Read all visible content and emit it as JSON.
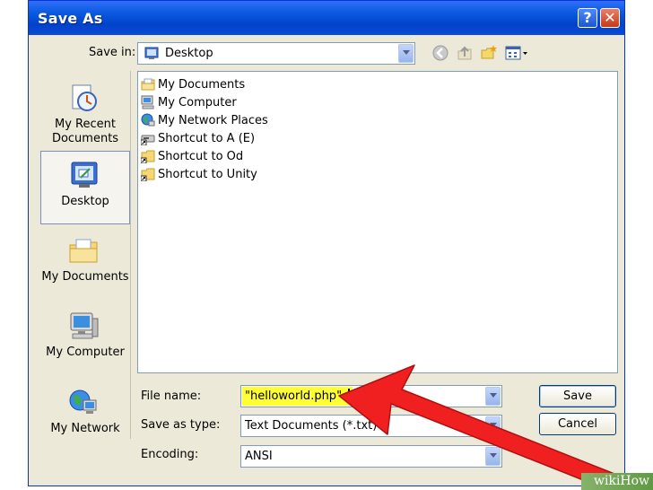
{
  "window": {
    "title": "Save As",
    "help_label": "?",
    "close_label": "✕"
  },
  "save_in": {
    "label": "Save in:",
    "value": "Desktop"
  },
  "toolbar": {
    "icons": [
      "back-icon",
      "up-folder-icon",
      "new-folder-icon",
      "views-menu-icon"
    ]
  },
  "places": [
    {
      "label": "My Recent\nDocuments",
      "icon": "recent-documents-icon",
      "active": false
    },
    {
      "label": "Desktop",
      "icon": "desktop-icon",
      "active": true
    },
    {
      "label": "My Documents",
      "icon": "my-documents-icon",
      "active": false
    },
    {
      "label": "My Computer",
      "icon": "my-computer-icon",
      "active": false
    },
    {
      "label": "My Network",
      "icon": "my-network-icon",
      "active": false
    }
  ],
  "files": [
    {
      "name": "My Documents",
      "icon": "my-documents-icon"
    },
    {
      "name": "My Computer",
      "icon": "my-computer-icon"
    },
    {
      "name": "My Network Places",
      "icon": "network-places-icon"
    },
    {
      "name": "Shortcut to A (E)",
      "icon": "drive-shortcut-icon"
    },
    {
      "name": "Shortcut to Od",
      "icon": "folder-shortcut-icon"
    },
    {
      "name": "Shortcut to Unity",
      "icon": "folder-shortcut-icon"
    }
  ],
  "form": {
    "file_name_label": "File name:",
    "file_name_value": "\"helloworld.php\"",
    "save_type_label": "Save as type:",
    "save_type_value": "Text Documents (*.txt)",
    "encoding_label": "Encoding:",
    "encoding_value": "ANSI"
  },
  "buttons": {
    "save": "Save",
    "cancel": "Cancel"
  },
  "watermark": "wikiHow",
  "colors": {
    "titlebar": "#0a5ae0",
    "highlight": "#ffff33",
    "arrow": "#f02020"
  }
}
